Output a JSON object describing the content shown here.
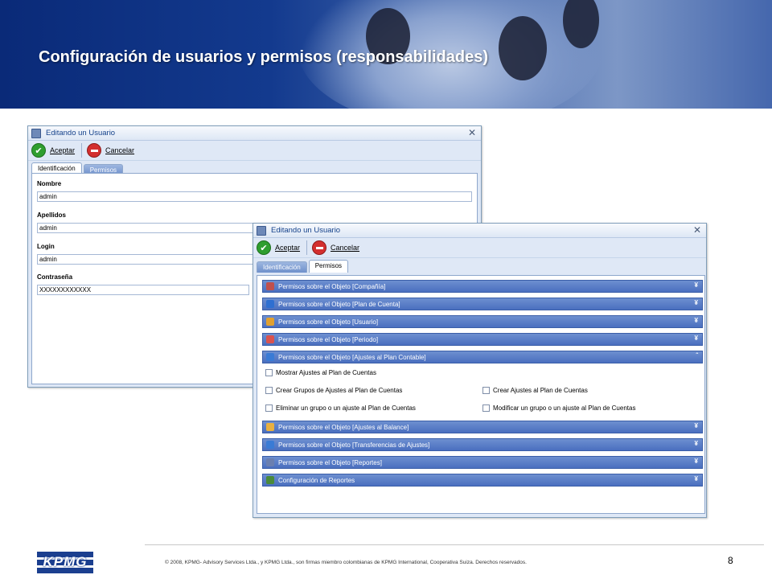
{
  "slide": {
    "title": "Configuración de usuarios y permisos (responsabilidades)",
    "page_number": "8",
    "copyright": "© 2008, KPMG- Advisory Services Ltda., y KPMG Ltda., son firmas miembro colombianas de KPMG International, Cooperativa Suiza. Derechos reservados.",
    "logo_text": "KPMG",
    "brand_color": "#1b3f8f"
  },
  "window1": {
    "title": "Editando un Usuario",
    "accept_label": "Aceptar",
    "cancel_label": "Cancelar",
    "tabs": [
      {
        "label": "Identificación",
        "active": true
      },
      {
        "label": "Permisos",
        "active": false
      }
    ],
    "fields": [
      {
        "label": "Nombre",
        "value": "admin"
      },
      {
        "label": "Apellidos",
        "value": "admin"
      },
      {
        "label": "Login",
        "value": "admin"
      },
      {
        "label": "Contraseña",
        "value": "XXXXXXXXXXXX"
      }
    ]
  },
  "window2": {
    "title": "Editando un Usuario",
    "accept_label": "Aceptar",
    "cancel_label": "Cancelar",
    "tabs": [
      {
        "label": "Identificación",
        "active": false
      },
      {
        "label": "Permisos",
        "active": true
      }
    ],
    "sections": [
      {
        "label": "Permisos sobre el Objeto [Compañía]",
        "icon": "company-icon",
        "color": "#c0504d"
      },
      {
        "label": "Permisos sobre el Objeto [Plan de Cuenta]",
        "icon": "account-plan-icon",
        "color": "#2e6fd1"
      },
      {
        "label": "Permisos sobre el Objeto [Usuario]",
        "icon": "user-icon",
        "color": "#e0a030"
      },
      {
        "label": "Permisos sobre el Objeto [Periodo]",
        "icon": "calendar-icon",
        "color": "#d9534f"
      },
      {
        "label": "Permisos sobre el Objeto [Ajustes al Plan Contable]",
        "icon": "adjust-icon",
        "color": "#3a7bd5"
      },
      {
        "label": "Permisos sobre el Objeto [Ajustes al Balance]",
        "icon": "balance-icon",
        "color": "#e8b040"
      },
      {
        "label": "Permisos sobre el Objeto [Transferencias de Ajustes]",
        "icon": "transfer-icon",
        "color": "#3a7bd5"
      },
      {
        "label": "Permisos sobre el Objeto [Reportes]",
        "icon": "report-icon",
        "color": "#6a7fb0"
      },
      {
        "label": "Configuración de Reportes",
        "icon": "config-reports-icon",
        "color": "#4a8a3a"
      }
    ],
    "permissions": [
      "Mostrar Ajustes al Plan de Cuentas",
      "Crear Grupos de Ajustes al Plan de Cuentas",
      "Crear Ajustes al Plan de Cuentas",
      "Eliminar un grupo o un ajuste al Plan de Cuentas",
      "Modificar un grupo o un ajuste al Plan de Cuentas"
    ]
  }
}
